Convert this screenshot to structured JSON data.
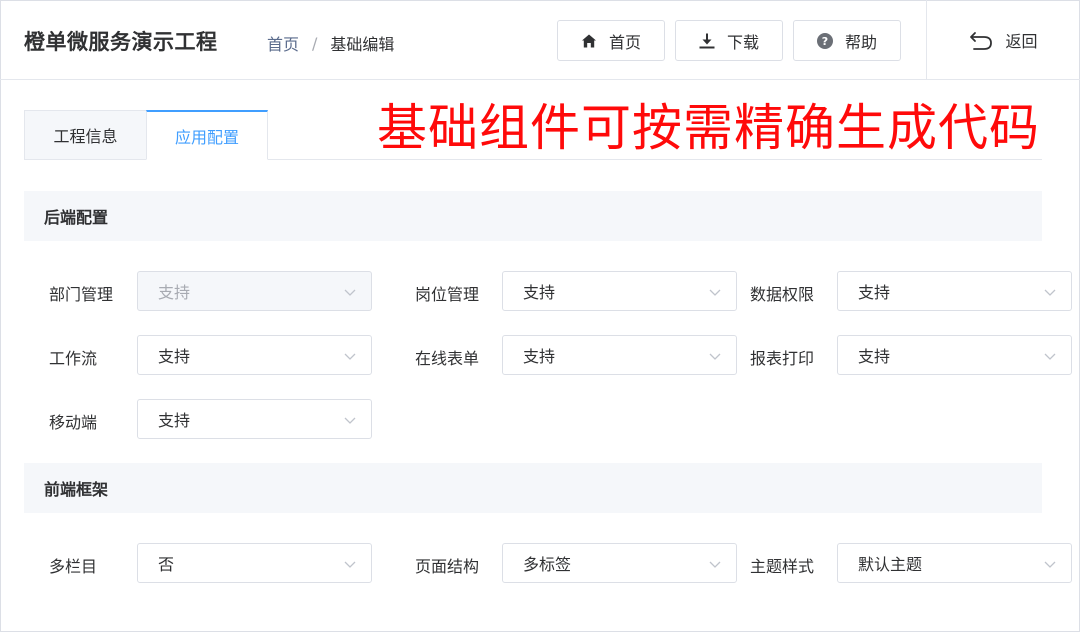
{
  "header": {
    "app_title": "橙单微服务演示工程",
    "breadcrumb": {
      "home": "首页",
      "separator": "/",
      "current": "基础编辑"
    },
    "buttons": {
      "home": "首页",
      "download": "下载",
      "help": "帮助"
    },
    "back": "返回"
  },
  "tabs": [
    {
      "label": "工程信息",
      "active": false
    },
    {
      "label": "应用配置",
      "active": true
    }
  ],
  "overlay_text": "基础组件可按需精确生成代码",
  "sections": {
    "backend": {
      "title": "后端配置",
      "fields": [
        {
          "label": "部门管理",
          "value": "支持",
          "disabled": true
        },
        {
          "label": "岗位管理",
          "value": "支持"
        },
        {
          "label": "数据权限",
          "value": "支持"
        },
        {
          "label": "工作流",
          "value": "支持"
        },
        {
          "label": "在线表单",
          "value": "支持"
        },
        {
          "label": "报表打印",
          "value": "支持"
        },
        {
          "label": "移动端",
          "value": "支持"
        }
      ]
    },
    "frontend": {
      "title": "前端框架",
      "fields": [
        {
          "label": "多栏目",
          "value": "否"
        },
        {
          "label": "页面结构",
          "value": "多标签"
        },
        {
          "label": "主题样式",
          "value": "默认主题"
        }
      ]
    }
  },
  "colors": {
    "accent": "#409eff",
    "overlay": "#ff0a0a",
    "section_bg": "#f5f7fa",
    "border": "#dcdfe6"
  },
  "icons": {
    "home": "home-icon",
    "download": "download-icon",
    "help": "help-circle-icon",
    "back": "back-arrow-icon",
    "select": "chevron-down-icon"
  }
}
